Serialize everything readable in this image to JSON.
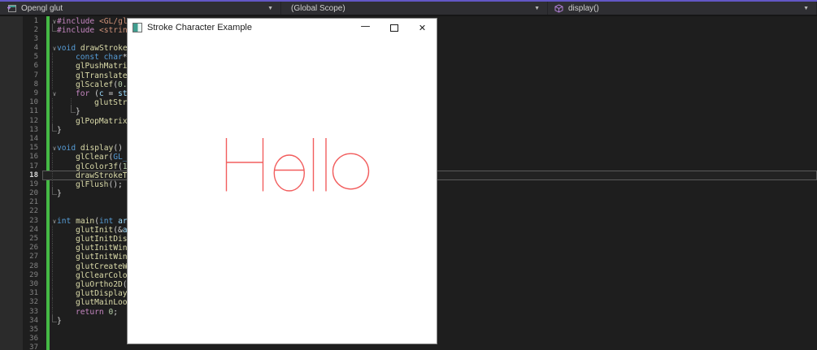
{
  "colors": {
    "top_strip": "#6257c6",
    "navbar_bg": "#2e2e32",
    "editor_bg": "#1e1e1e",
    "modified_bar": "#45b945",
    "current_line_border": "#5a5a5a",
    "stroke_text": "#f25e5e"
  },
  "nav": {
    "project": "Opengl glut",
    "scope": "(Global Scope)",
    "member": "display()",
    "arrow": "▼"
  },
  "window": {
    "title": "Stroke Character Example",
    "content_text": "Hello",
    "minimize": "—",
    "close": "✕"
  },
  "editor": {
    "current_line": 18,
    "fold_glyph": "∨",
    "token_colors": {
      "pp": "#c586c0",
      "kw": "#569cd6",
      "fn": "#dcdcaa",
      "str": "#ce9178",
      "num": "#b5cea8",
      "var": "#9cdcfe",
      "pl": "#d4d4d4"
    },
    "lines": [
      {
        "n": 1,
        "fold": true,
        "tk": [
          [
            "pp",
            "#include "
          ],
          [
            "str",
            "<GL/gl"
          ]
        ]
      },
      {
        "n": 2,
        "c": 64,
        "tk": [
          [
            "pp",
            "#include "
          ],
          [
            "str",
            "<strin"
          ]
        ]
      },
      {
        "n": 3
      },
      {
        "n": 4,
        "fold": true,
        "tk": [
          [
            "kw",
            "void "
          ],
          [
            "fn",
            "drawStrokeT"
          ]
        ]
      },
      {
        "n": 5,
        "g": [
          64
        ],
        "ind": 1,
        "tk": [
          [
            "kw",
            "const "
          ],
          [
            "kw",
            "char"
          ],
          [
            "pl",
            "*"
          ]
        ]
      },
      {
        "n": 6,
        "g": [
          64
        ],
        "ind": 1,
        "tk": [
          [
            "fn",
            "glPushMatri"
          ]
        ]
      },
      {
        "n": 7,
        "g": [
          64
        ],
        "ind": 1,
        "tk": [
          [
            "fn",
            "glTranslate"
          ]
        ]
      },
      {
        "n": 8,
        "g": [
          64
        ],
        "ind": 1,
        "tk": [
          [
            "fn",
            "glScalef"
          ],
          [
            "pl",
            "("
          ],
          [
            "num",
            "0."
          ]
        ]
      },
      {
        "n": 9,
        "fold": true,
        "ind": 1,
        "tk": [
          [
            "pp",
            "for "
          ],
          [
            "pl",
            "("
          ],
          [
            "var",
            "c"
          ],
          [
            "pl",
            " = "
          ],
          [
            "var",
            "st"
          ]
        ]
      },
      {
        "n": 10,
        "g": [
          64,
          87
        ],
        "ind": 2,
        "tk": [
          [
            "fn",
            "glutStr"
          ]
        ]
      },
      {
        "n": 11,
        "g": [
          64
        ],
        "c": 87,
        "ind": 1,
        "tk": [
          [
            "pl",
            "}"
          ]
        ]
      },
      {
        "n": 12,
        "g": [
          64
        ],
        "ind": 1,
        "tk": [
          [
            "fn",
            "glPopMatrix"
          ]
        ]
      },
      {
        "n": 13,
        "c": 64,
        "tk": [
          [
            "pl",
            "}"
          ]
        ]
      },
      {
        "n": 14
      },
      {
        "n": 15,
        "fold": true,
        "tk": [
          [
            "kw",
            "void "
          ],
          [
            "fn",
            "display"
          ],
          [
            "pl",
            "()"
          ]
        ]
      },
      {
        "n": 16,
        "g": [
          64
        ],
        "ind": 1,
        "tk": [
          [
            "fn",
            "glClear"
          ],
          [
            "pl",
            "("
          ],
          [
            "kw",
            "GL_"
          ]
        ]
      },
      {
        "n": 17,
        "g": [
          64
        ],
        "ind": 1,
        "tk": [
          [
            "fn",
            "glColor3f"
          ],
          [
            "pl",
            "("
          ],
          [
            "num",
            "1"
          ]
        ]
      },
      {
        "n": 18,
        "g": [
          64
        ],
        "ind": 1,
        "tk": [
          [
            "fn",
            "drawStrokeT"
          ]
        ]
      },
      {
        "n": 19,
        "g": [
          64
        ],
        "ind": 1,
        "tk": [
          [
            "fn",
            "glFlush"
          ],
          [
            "pl",
            "();"
          ]
        ]
      },
      {
        "n": 20,
        "c": 64,
        "tk": [
          [
            "pl",
            "}"
          ]
        ]
      },
      {
        "n": 21
      },
      {
        "n": 22
      },
      {
        "n": 23,
        "fold": true,
        "tk": [
          [
            "kw",
            "int "
          ],
          [
            "fn",
            "main"
          ],
          [
            "pl",
            "("
          ],
          [
            "kw",
            "int "
          ],
          [
            "var",
            "ar"
          ]
        ]
      },
      {
        "n": 24,
        "g": [
          64
        ],
        "ind": 1,
        "tk": [
          [
            "fn",
            "glutInit"
          ],
          [
            "pl",
            "(&"
          ],
          [
            "var",
            "a"
          ]
        ]
      },
      {
        "n": 25,
        "g": [
          64
        ],
        "ind": 1,
        "tk": [
          [
            "fn",
            "glutInitDis"
          ]
        ]
      },
      {
        "n": 26,
        "g": [
          64
        ],
        "ind": 1,
        "tk": [
          [
            "fn",
            "glutInitWin"
          ]
        ]
      },
      {
        "n": 27,
        "g": [
          64
        ],
        "ind": 1,
        "tk": [
          [
            "fn",
            "glutInitWin"
          ]
        ]
      },
      {
        "n": 28,
        "g": [
          64
        ],
        "ind": 1,
        "tk": [
          [
            "fn",
            "glutCreateW"
          ]
        ]
      },
      {
        "n": 29,
        "g": [
          64
        ],
        "ind": 1,
        "tk": [
          [
            "fn",
            "glClearColo"
          ]
        ]
      },
      {
        "n": 30,
        "g": [
          64
        ],
        "ind": 1,
        "tk": [
          [
            "fn",
            "gluOrtho2D"
          ],
          [
            "pl",
            "("
          ]
        ]
      },
      {
        "n": 31,
        "g": [
          64
        ],
        "ind": 1,
        "tk": [
          [
            "fn",
            "glutDisplay"
          ]
        ]
      },
      {
        "n": 32,
        "g": [
          64
        ],
        "ind": 1,
        "tk": [
          [
            "fn",
            "glutMainLoo"
          ]
        ]
      },
      {
        "n": 33,
        "g": [
          64
        ],
        "ind": 1,
        "tk": [
          [
            "pp",
            "return "
          ],
          [
            "num",
            "0"
          ],
          [
            "pl",
            ";"
          ]
        ]
      },
      {
        "n": 34,
        "c": 64,
        "tk": [
          [
            "pl",
            "}"
          ]
        ]
      },
      {
        "n": 35
      },
      {
        "n": 36
      },
      {
        "n": 37
      }
    ]
  }
}
